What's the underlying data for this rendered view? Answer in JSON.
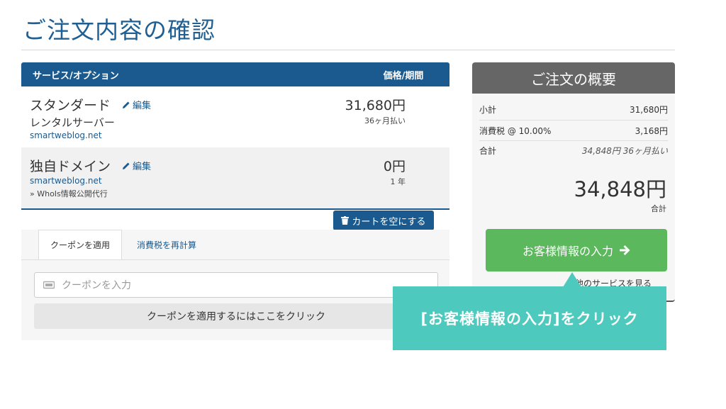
{
  "page": {
    "title": "ご注文内容の確認"
  },
  "cart": {
    "header": {
      "service": "サービス/オプション",
      "price": "価格/期間"
    },
    "items": [
      {
        "name": "スタンダード",
        "edit": "編集",
        "sub": "レンタルサーバー",
        "domain": "smartweblog.net",
        "note": "",
        "price": "31,680円",
        "period": "36ヶ月払い"
      },
      {
        "name": "独自ドメイン",
        "edit": "編集",
        "sub": "",
        "domain": "smartweblog.net",
        "note": "» WhoIs情報公開代行",
        "price": "0円",
        "period": "1 年"
      }
    ],
    "empty_label": "カートを空にする"
  },
  "promo": {
    "tabs": [
      "クーポンを適用",
      "消費税を再計算"
    ],
    "coupon_placeholder": "クーポンを入力",
    "apply_label": "クーポンを適用するにはここをクリック"
  },
  "summary": {
    "title": "ご注文の概要",
    "rows": [
      {
        "label": "小計",
        "value": "31,680円"
      },
      {
        "label": "消費税 @ 10.00%",
        "value": "3,168円"
      },
      {
        "label": "合計",
        "value": "34,848円 36ヶ月払い"
      }
    ],
    "total": "34,848円",
    "total_label": "合計",
    "checkout_label": "お客様情報の入力",
    "more_link": "他のサービスを見る"
  },
  "callout": {
    "text": "[お客様情報の入力]をクリック"
  },
  "colors": {
    "primary": "#1a5a8e",
    "success": "#5cb85c",
    "callout": "#4ec9bd",
    "summary_header": "#666666"
  }
}
